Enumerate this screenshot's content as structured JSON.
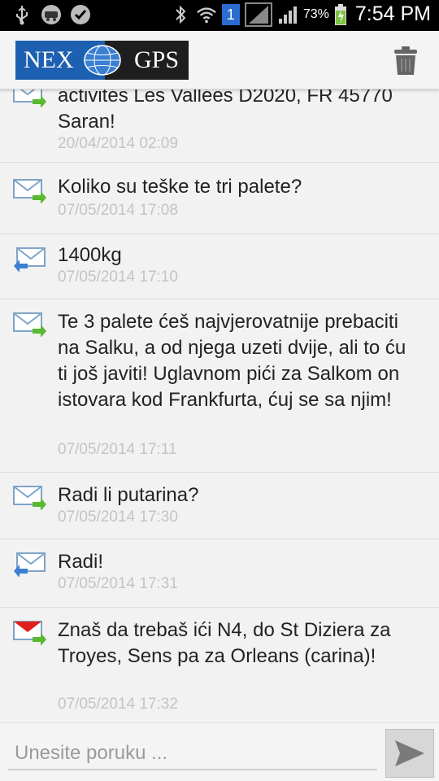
{
  "status_bar": {
    "battery_percent": "73%",
    "time": "7:54 PM",
    "sim_label": "1"
  },
  "app_bar": {
    "logo_left": "NEX",
    "logo_right": "GPS"
  },
  "messages": [
    {
      "direction": "outgoing",
      "text": "activités Les Vallées D2020, FR 45770 Saran!",
      "time": "20/04/2014 02:09"
    },
    {
      "direction": "outgoing",
      "text": "Koliko su teške te tri palete?",
      "time": "07/05/2014 17:08"
    },
    {
      "direction": "incoming",
      "text": "1400kg",
      "time": "07/05/2014 17:10"
    },
    {
      "direction": "outgoing",
      "text": "Te 3 palete ćeš najvjerovatnije prebaciti na Salku, a od njega uzeti dvije, ali to ću ti još javiti! Uglavnom pići za Salkom on istovara kod Frankfurta, ćuj se sa njim!",
      "time": "07/05/2014 17:11"
    },
    {
      "direction": "outgoing",
      "text": "Radi li putarina?",
      "time": "07/05/2014 17:30"
    },
    {
      "direction": "incoming",
      "text": "Radi!",
      "time": "07/05/2014 17:31"
    },
    {
      "direction": "outgoing-unread",
      "text": "Znaš da trebaš ići N4, do St Diziera za Troyes, Sens pa za Orleans (carina)!",
      "time": "07/05/2014 17:32"
    }
  ],
  "composer": {
    "placeholder": "Unesite poruku ..."
  }
}
